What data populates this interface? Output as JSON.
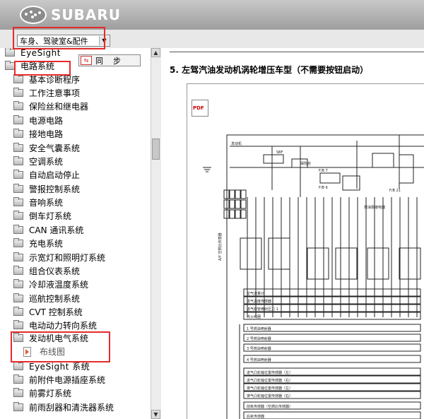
{
  "header": {
    "brand": "SUBARU"
  },
  "toolbar": {
    "category_select": "车身、驾驶室&配件"
  },
  "sync": {
    "label": "同步"
  },
  "sidebar": {
    "items": [
      {
        "label": "EyeSight",
        "level": 0
      },
      {
        "label": "电路系统",
        "level": 0
      },
      {
        "label": "基本诊断程序",
        "level": 1
      },
      {
        "label": "工作注意事项",
        "level": 1
      },
      {
        "label": "保险丝和继电器",
        "level": 1
      },
      {
        "label": "电源电路",
        "level": 1
      },
      {
        "label": "接地电路",
        "level": 1
      },
      {
        "label": "安全气囊系统",
        "level": 1
      },
      {
        "label": "空调系统",
        "level": 1
      },
      {
        "label": "自动启动停止",
        "level": 1
      },
      {
        "label": "警报控制系统",
        "level": 1
      },
      {
        "label": "音响系统",
        "level": 1
      },
      {
        "label": "倒车灯系统",
        "level": 1
      },
      {
        "label": "CAN 通讯系统",
        "level": 1
      },
      {
        "label": "充电系统",
        "level": 1
      },
      {
        "label": "示宽灯和照明灯系统",
        "level": 1
      },
      {
        "label": "组合仪表系统",
        "level": 1
      },
      {
        "label": "冷却液温度系统",
        "level": 1
      },
      {
        "label": "巡航控制系统",
        "level": 1
      },
      {
        "label": "CVT 控制系统",
        "level": 1
      },
      {
        "label": "电动动力转向系统",
        "level": 1
      },
      {
        "label": "发动机电气系统",
        "level": 1
      },
      {
        "label": "布线图",
        "level": 2
      },
      {
        "label": "EyeSight 系统",
        "level": 1
      },
      {
        "label": "前附件电源插座系统",
        "level": 1
      },
      {
        "label": "前雾灯系统",
        "level": 1
      },
      {
        "label": "前雨刮器和清洗器系统",
        "level": 1
      }
    ]
  },
  "content": {
    "section_title": "5.  左驾汽油发动机涡轮增压车型（不需要按钮启动）"
  },
  "diagram": {
    "top_labels": [
      "发动机",
      "SBF",
      "保险丝",
      "F/B 7",
      "F/B 6",
      "燃油泵继电器",
      "F/B 21"
    ],
    "side_label": "A/F 空燃比传感器",
    "rows": [
      "空气流量计",
      "进气温度传感器",
      "进气歧管绝对压力 1",
      "点火线圈",
      "1 号燃油喷射器",
      "2 号燃油喷射器",
      "3 号燃油喷射器",
      "4 号燃油喷射器",
      "进气凸轮轴位置传感器（左）",
      "进气凸轮轴位置传感器（右）",
      "排气凸轮轴位置传感器（左）",
      "排气凸轮轴位置传感器（右）",
      "前氧传感器（空燃比传感器）",
      "后氧传感器"
    ]
  },
  "colors": {
    "highlight": "#e52b2b",
    "header": "#b0b0b0"
  }
}
